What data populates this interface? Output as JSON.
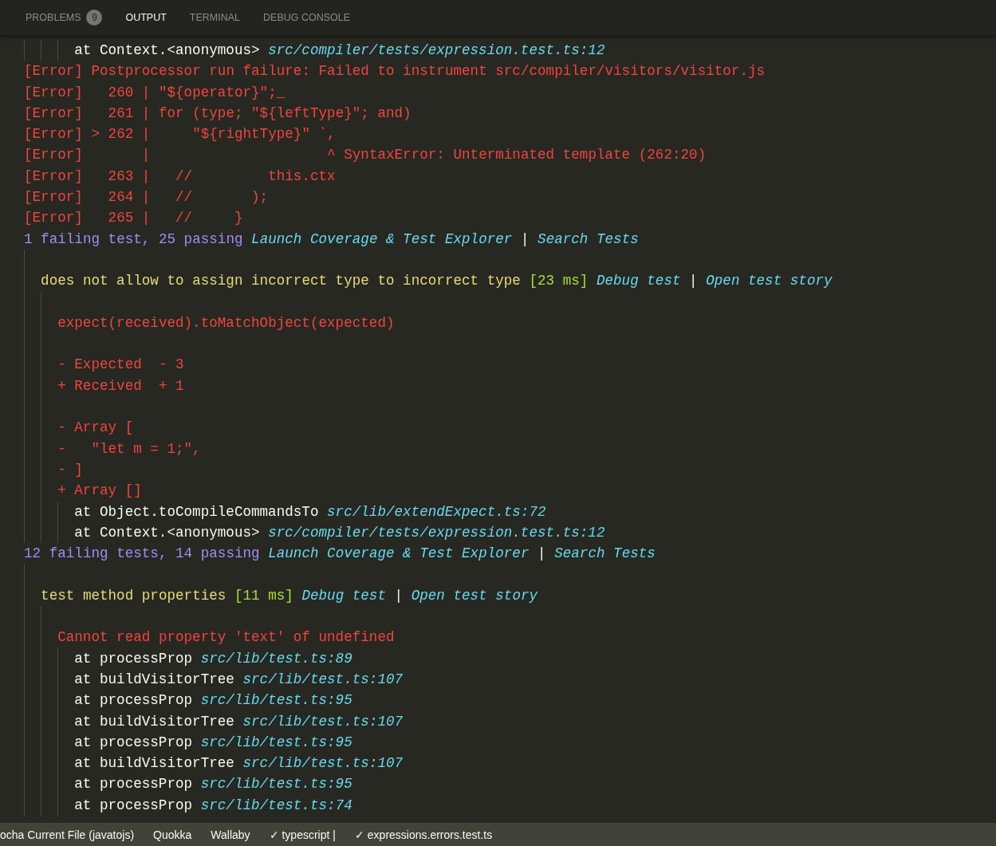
{
  "panel_tabs": [
    {
      "label": "PROBLEMS",
      "selected": false,
      "badge": "9"
    },
    {
      "label": "OUTPUT",
      "selected": true
    },
    {
      "label": "TERMINAL",
      "selected": false
    },
    {
      "label": "DEBUG CONSOLE",
      "selected": false
    }
  ],
  "output": [
    {
      "kind": "group",
      "children": [
        {
          "kind": "group",
          "children": [
            {
              "kind": "group",
              "children": [
                {
                  "kind": "line",
                  "segments": [
                    {
                      "kind": "text",
                      "text": "at Context.<anonymous>"
                    },
                    {
                      "kind": "link",
                      "text": "src/compiler/tests/expression.test.ts:12"
                    }
                  ]
                }
              ]
            }
          ]
        }
      ]
    },
    {
      "kind": "line",
      "segments": [
        {
          "kind": "error",
          "text": "[Error] Postprocessor run failure: Failed to instrument src/compiler/visitors/visitor.js"
        }
      ]
    },
    {
      "kind": "line",
      "segments": [
        {
          "kind": "error",
          "text": "[Error]   260 | \"${operator}\";_"
        }
      ]
    },
    {
      "kind": "line",
      "segments": [
        {
          "kind": "error",
          "text": "[Error]   261 | for (type; \"${leftType}\"; and)"
        }
      ]
    },
    {
      "kind": "line",
      "segments": [
        {
          "kind": "error",
          "text": "[Error] > 262 |     \"${rightType}\" `,"
        }
      ]
    },
    {
      "kind": "line",
      "segments": [
        {
          "kind": "error",
          "text": "[Error]       |                     ^ SyntaxError: Unterminated template (262:20)"
        }
      ]
    },
    {
      "kind": "line",
      "segments": [
        {
          "kind": "error",
          "text": "[Error]   263 |   //         this.ctx"
        }
      ]
    },
    {
      "kind": "line",
      "segments": [
        {
          "kind": "error",
          "text": "[Error]   264 |   //       );"
        }
      ]
    },
    {
      "kind": "line",
      "segments": [
        {
          "kind": "error",
          "text": "[Error]   265 |   //     }"
        }
      ]
    },
    {
      "kind": "line",
      "segments": [
        {
          "kind": "count",
          "text": "1 failing test, 25 passing"
        },
        {
          "kind": "link",
          "text": "Launch Coverage & Test Explorer"
        },
        {
          "kind": "sep",
          "text": "|"
        },
        {
          "kind": "link",
          "text": "Search Tests"
        }
      ]
    },
    {
      "kind": "group",
      "children": [
        {
          "kind": "blank"
        },
        {
          "kind": "line",
          "segments": [
            {
              "kind": "title",
              "text": "does not allow to assign incorrect type to incorrect type"
            },
            {
              "kind": "time",
              "text": "[23 ms]"
            },
            {
              "kind": "link",
              "text": "Debug test"
            },
            {
              "kind": "sep",
              "text": "|"
            },
            {
              "kind": "link",
              "text": "Open test story"
            }
          ]
        },
        {
          "kind": "group",
          "children": [
            {
              "kind": "blank"
            },
            {
              "kind": "line",
              "segments": [
                {
                  "kind": "error",
                  "text": "expect(received).toMatchObject(expected)"
                }
              ]
            },
            {
              "kind": "blank"
            },
            {
              "kind": "line",
              "segments": [
                {
                  "kind": "error",
                  "text": "- Expected  - 3"
                }
              ]
            },
            {
              "kind": "line",
              "segments": [
                {
                  "kind": "error",
                  "text": "+ Received  + 1"
                }
              ]
            },
            {
              "kind": "blank"
            },
            {
              "kind": "line",
              "segments": [
                {
                  "kind": "error",
                  "text": "- Array ["
                }
              ]
            },
            {
              "kind": "line",
              "segments": [
                {
                  "kind": "error",
                  "text": "-   \"let m = 1;\","
                }
              ]
            },
            {
              "kind": "line",
              "segments": [
                {
                  "kind": "error",
                  "text": "- ]"
                }
              ]
            },
            {
              "kind": "line",
              "segments": [
                {
                  "kind": "error",
                  "text": "+ Array []"
                }
              ]
            },
            {
              "kind": "group",
              "children": [
                {
                  "kind": "line",
                  "segments": [
                    {
                      "kind": "text",
                      "text": "at Object.toCompileCommandsTo"
                    },
                    {
                      "kind": "link",
                      "text": "src/lib/extendExpect.ts:72"
                    }
                  ]
                },
                {
                  "kind": "line",
                  "segments": [
                    {
                      "kind": "text",
                      "text": "at Context.<anonymous>"
                    },
                    {
                      "kind": "link",
                      "text": "src/compiler/tests/expression.test.ts:12"
                    }
                  ]
                }
              ]
            }
          ]
        }
      ]
    },
    {
      "kind": "line",
      "segments": [
        {
          "kind": "count",
          "text": "12 failing tests, 14 passing"
        },
        {
          "kind": "link",
          "text": "Launch Coverage & Test Explorer"
        },
        {
          "kind": "sep",
          "text": "|"
        },
        {
          "kind": "link",
          "text": "Search Tests"
        }
      ]
    },
    {
      "kind": "group",
      "children": [
        {
          "kind": "blank"
        },
        {
          "kind": "line",
          "segments": [
            {
              "kind": "title",
              "text": "test method properties"
            },
            {
              "kind": "time",
              "text": "[11 ms]"
            },
            {
              "kind": "link",
              "text": "Debug test"
            },
            {
              "kind": "sep",
              "text": "|"
            },
            {
              "kind": "link",
              "text": "Open test story"
            }
          ]
        },
        {
          "kind": "group",
          "children": [
            {
              "kind": "blank"
            },
            {
              "kind": "line",
              "segments": [
                {
                  "kind": "error",
                  "text": "Cannot read property 'text' of undefined"
                }
              ]
            },
            {
              "kind": "group",
              "children": [
                {
                  "kind": "line",
                  "segments": [
                    {
                      "kind": "text",
                      "text": "at processProp"
                    },
                    {
                      "kind": "link",
                      "text": "src/lib/test.ts:89"
                    }
                  ]
                },
                {
                  "kind": "line",
                  "segments": [
                    {
                      "kind": "text",
                      "text": "at buildVisitorTree"
                    },
                    {
                      "kind": "link",
                      "text": "src/lib/test.ts:107"
                    }
                  ]
                },
                {
                  "kind": "line",
                  "segments": [
                    {
                      "kind": "text",
                      "text": "at processProp"
                    },
                    {
                      "kind": "link",
                      "text": "src/lib/test.ts:95"
                    }
                  ]
                },
                {
                  "kind": "line",
                  "segments": [
                    {
                      "kind": "text",
                      "text": "at buildVisitorTree"
                    },
                    {
                      "kind": "link",
                      "text": "src/lib/test.ts:107"
                    }
                  ]
                },
                {
                  "kind": "line",
                  "segments": [
                    {
                      "kind": "text",
                      "text": "at processProp"
                    },
                    {
                      "kind": "link",
                      "text": "src/lib/test.ts:95"
                    }
                  ]
                },
                {
                  "kind": "line",
                  "segments": [
                    {
                      "kind": "text",
                      "text": "at buildVisitorTree"
                    },
                    {
                      "kind": "link",
                      "text": "src/lib/test.ts:107"
                    }
                  ]
                },
                {
                  "kind": "line",
                  "segments": [
                    {
                      "kind": "text",
                      "text": "at processProp"
                    },
                    {
                      "kind": "link",
                      "text": "src/lib/test.ts:95"
                    }
                  ]
                },
                {
                  "kind": "line",
                  "segments": [
                    {
                      "kind": "text",
                      "text": "at processProp"
                    },
                    {
                      "kind": "link",
                      "text": "src/lib/test.ts:74"
                    }
                  ]
                }
              ]
            }
          ]
        }
      ]
    }
  ],
  "status_bar": [
    "ocha Current File (javatojs)",
    "Quokka",
    "Wallaby",
    "✓ typescript |",
    "✓ expressions.errors.test.ts"
  ]
}
